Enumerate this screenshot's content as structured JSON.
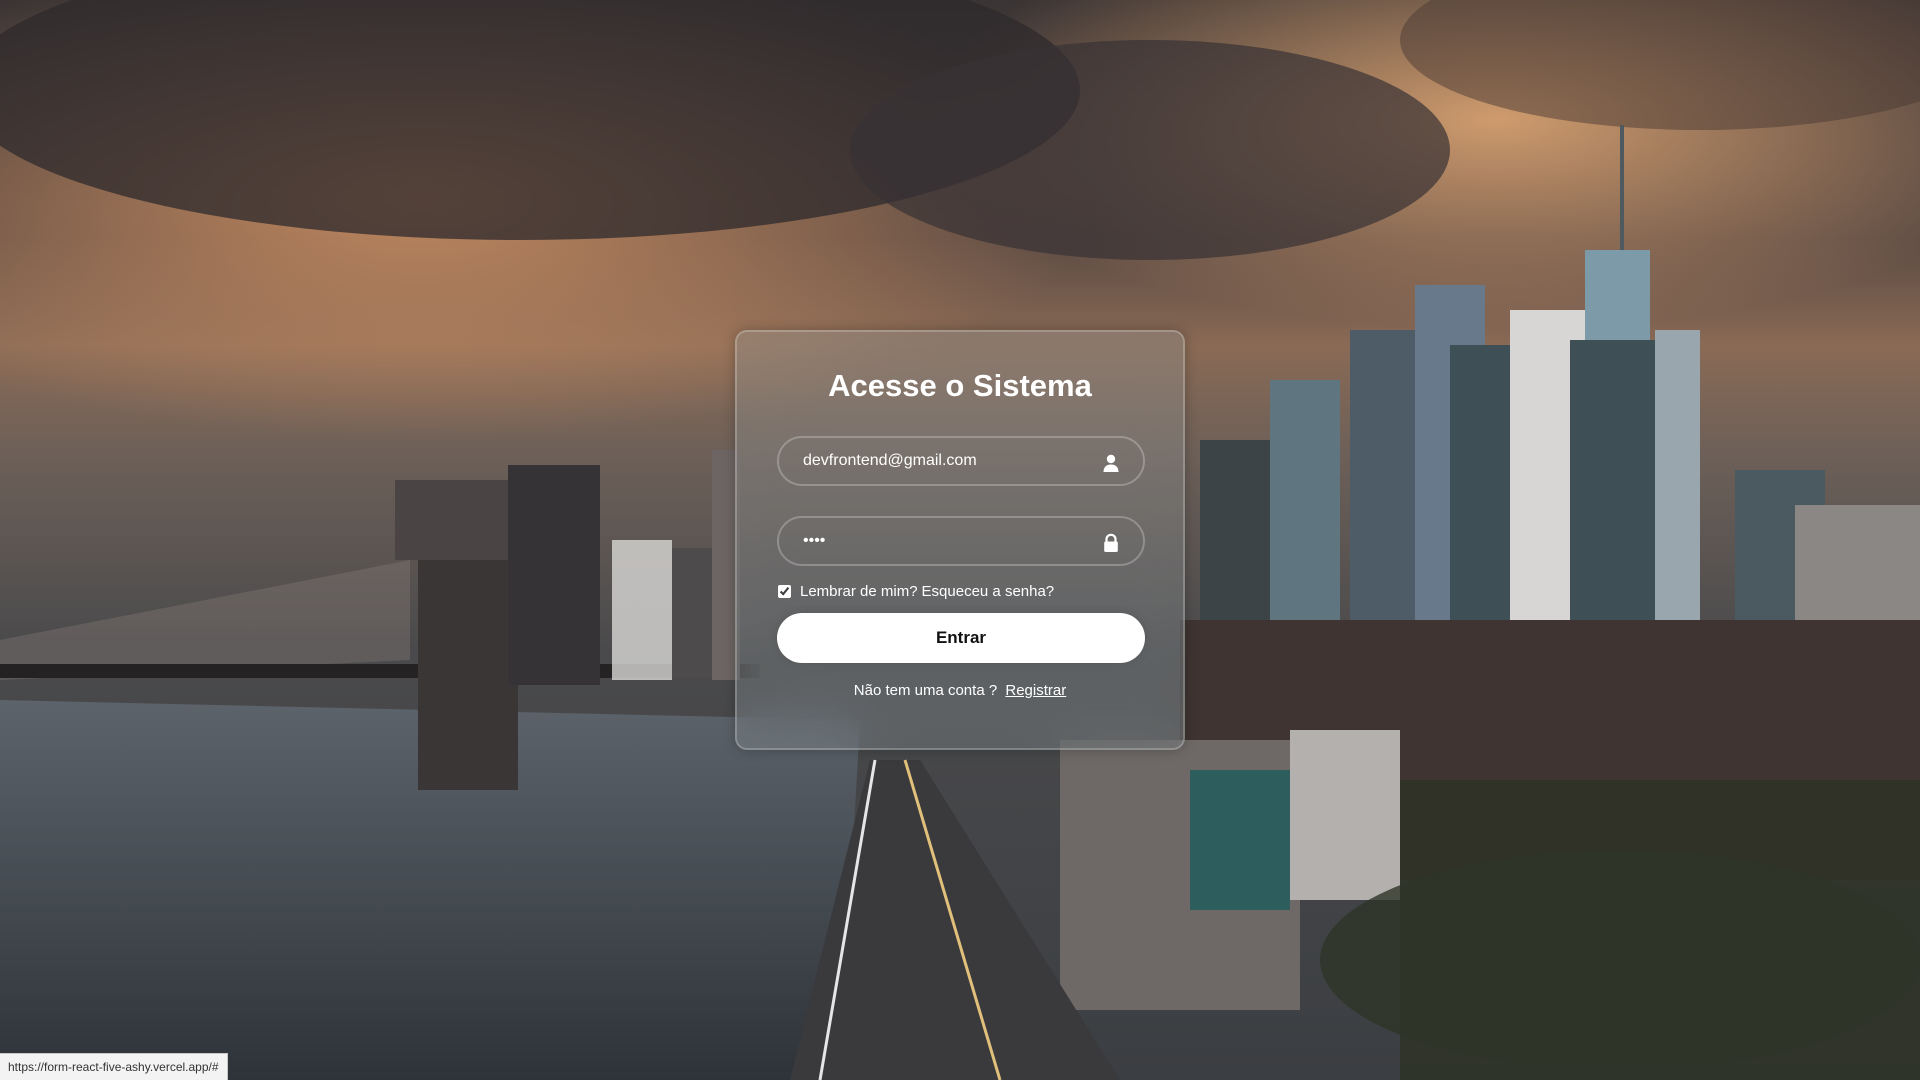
{
  "login": {
    "title": "Acesse o Sistema",
    "email_value": "devfrontend@gmail.com",
    "email_icon": "user-icon",
    "password_value": "••••",
    "password_icon": "lock-icon",
    "remember_checked": true,
    "remember_label": "Lembrar de mim?",
    "forgot_label": "Esqueceu a senha?",
    "submit_label": "Entrar",
    "signup_text": "Não tem uma conta ?",
    "signup_link": "Registrar"
  },
  "status_bar": {
    "url": "https://form-react-five-ashy.vercel.app/#"
  },
  "colors": {
    "card_text": "#ffffff",
    "button_bg": "#ffffff",
    "button_text": "#111111"
  }
}
